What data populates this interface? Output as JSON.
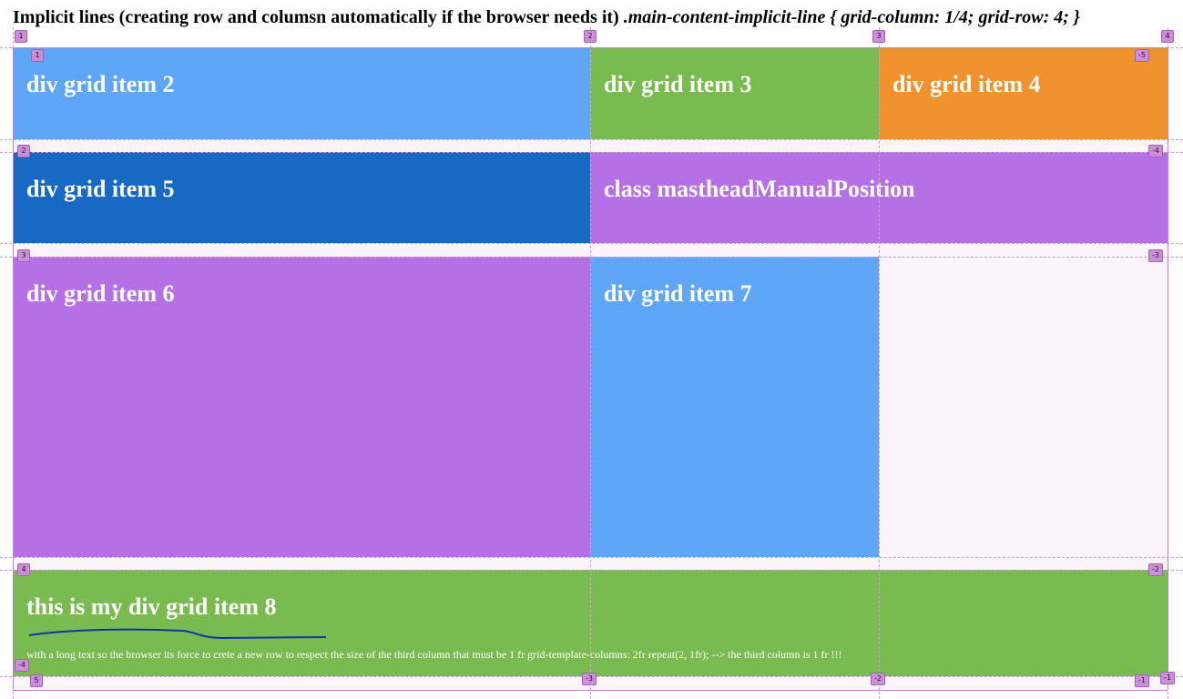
{
  "heading": {
    "plain": "Implicit lines (creating row and columsn automatically if the browser needs it) ",
    "code": ".main-content-implicit-line { grid-column: 1/4; grid-row: 4; }"
  },
  "items": {
    "item2": "div grid item 2",
    "item3": "div grid item 3",
    "item4": "div grid item 4",
    "item5": "div grid item 5",
    "masthead": "class mastheadManualPosition",
    "item6": "div grid item 6",
    "item7": "div grid item 7",
    "item8_title": "this is my div grid item 8",
    "item8_text": "with a long text so the browser its force to crete a new row to respect the size of the third column that must be 1 fr grid-template-columns: 2fr repeat(2, 1fr); --> the third column is 1 fr !!!"
  },
  "colors": {
    "light_blue": "#60a6f8",
    "green": "#7abb51",
    "orange": "#f0932f",
    "dark_blue": "#1769c4",
    "purple": "#b570e6",
    "grid_bg": "#fbf5fb",
    "line_marker": "#c990d8"
  },
  "line_numbers": {
    "col_top": [
      "1",
      "2",
      "3",
      "4"
    ],
    "row_left": [
      "1",
      "2",
      "3",
      "4",
      "-4"
    ],
    "row_right": [
      "-5",
      "-4",
      "-3",
      "-2",
      "-1"
    ],
    "col_bottom": [
      "5",
      "-3",
      "-2",
      "-1"
    ]
  }
}
